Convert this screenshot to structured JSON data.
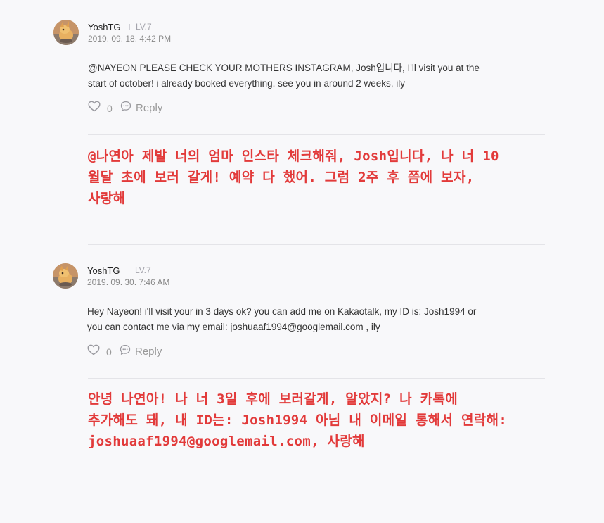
{
  "comments": [
    {
      "author": "YoshTG",
      "level": "LV.7",
      "date": "2019. 09. 18. 4:42 PM",
      "text_line1": "@NAYEON PLEASE CHECK YOUR MOTHERS INSTAGRAM, Josh입니다, I'll visit you at the",
      "text_line2": "start of october! i already booked everything. see you in around 2 weeks, ily",
      "likes": "0",
      "reply_label": "Reply",
      "translation_line1": "@나연아 제발 너의 엄마 인스타 체크해줘, Josh입니다, 나 너 10",
      "translation_line2": "월달 초에 보러 갈게! 예약 다 했어. 그럼 2주 후 쯤에 보자,",
      "translation_line3": "사랑해"
    },
    {
      "author": "YoshTG",
      "level": "LV.7",
      "date": "2019. 09. 30. 7:46 AM",
      "text_line1": "Hey Nayeon! i'll visit your in 3 days ok? you can add me on Kakaotalk, my ID is: Josh1994 or",
      "text_line2": "you can contact me via my email: joshuaaf1994@googlemail.com , ily",
      "likes": "0",
      "reply_label": "Reply",
      "translation_line1": "안녕 나연아! 나 너 3일 후에 보러갈게, 알았지? 나 카톡에",
      "translation_line2": "추가해도 돼, 내 ID는: Josh1994 아님 내 이메일 통해서 연락해:",
      "translation_line3": "joshuaaf1994@googlemail.com, 사랑해"
    }
  ],
  "icons": {
    "like": "heart-outline-icon",
    "reply": "speech-bubble-icon"
  },
  "colors": {
    "translation": "#e23a3a",
    "background": "#f8f8fa",
    "muted": "#999999"
  }
}
